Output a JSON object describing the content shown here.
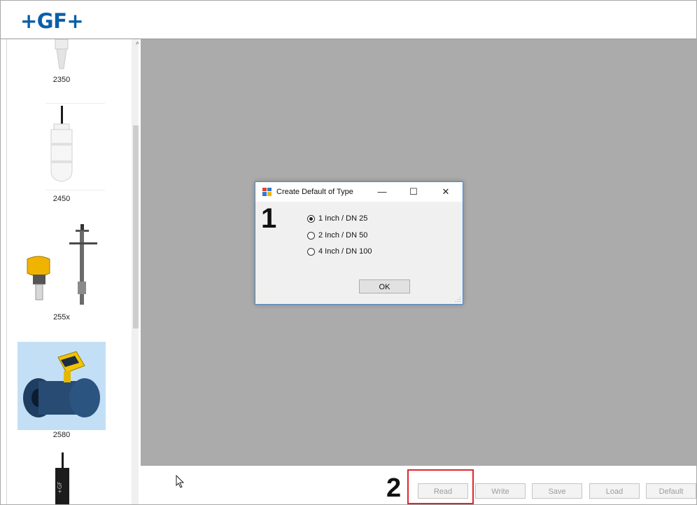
{
  "header": {
    "logo": "+GF+"
  },
  "sidebar": {
    "devices": [
      {
        "label": "2350"
      },
      {
        "label": "2450"
      },
      {
        "label": "255x"
      },
      {
        "label": "2580"
      },
      {
        "label": ""
      }
    ],
    "selected_index": 3
  },
  "dialog": {
    "title": "Create Default of Type",
    "options": [
      {
        "label": "1 Inch / DN 25",
        "selected": true
      },
      {
        "label": "2 Inch / DN 50",
        "selected": false
      },
      {
        "label": "4 Inch / DN 100",
        "selected": false
      }
    ],
    "ok_label": "OK",
    "minimize": "—",
    "maximize": "☐",
    "close": "✕"
  },
  "markers": {
    "one": "1",
    "two": "2"
  },
  "toolbar": {
    "read": "Read",
    "write": "Write",
    "save": "Save",
    "load": "Load",
    "default": "Default"
  },
  "colors": {
    "brand": "#0a5fa8",
    "canvas": "#aaabaa",
    "highlight": "#e0262d",
    "selection": "#c3dff5"
  }
}
